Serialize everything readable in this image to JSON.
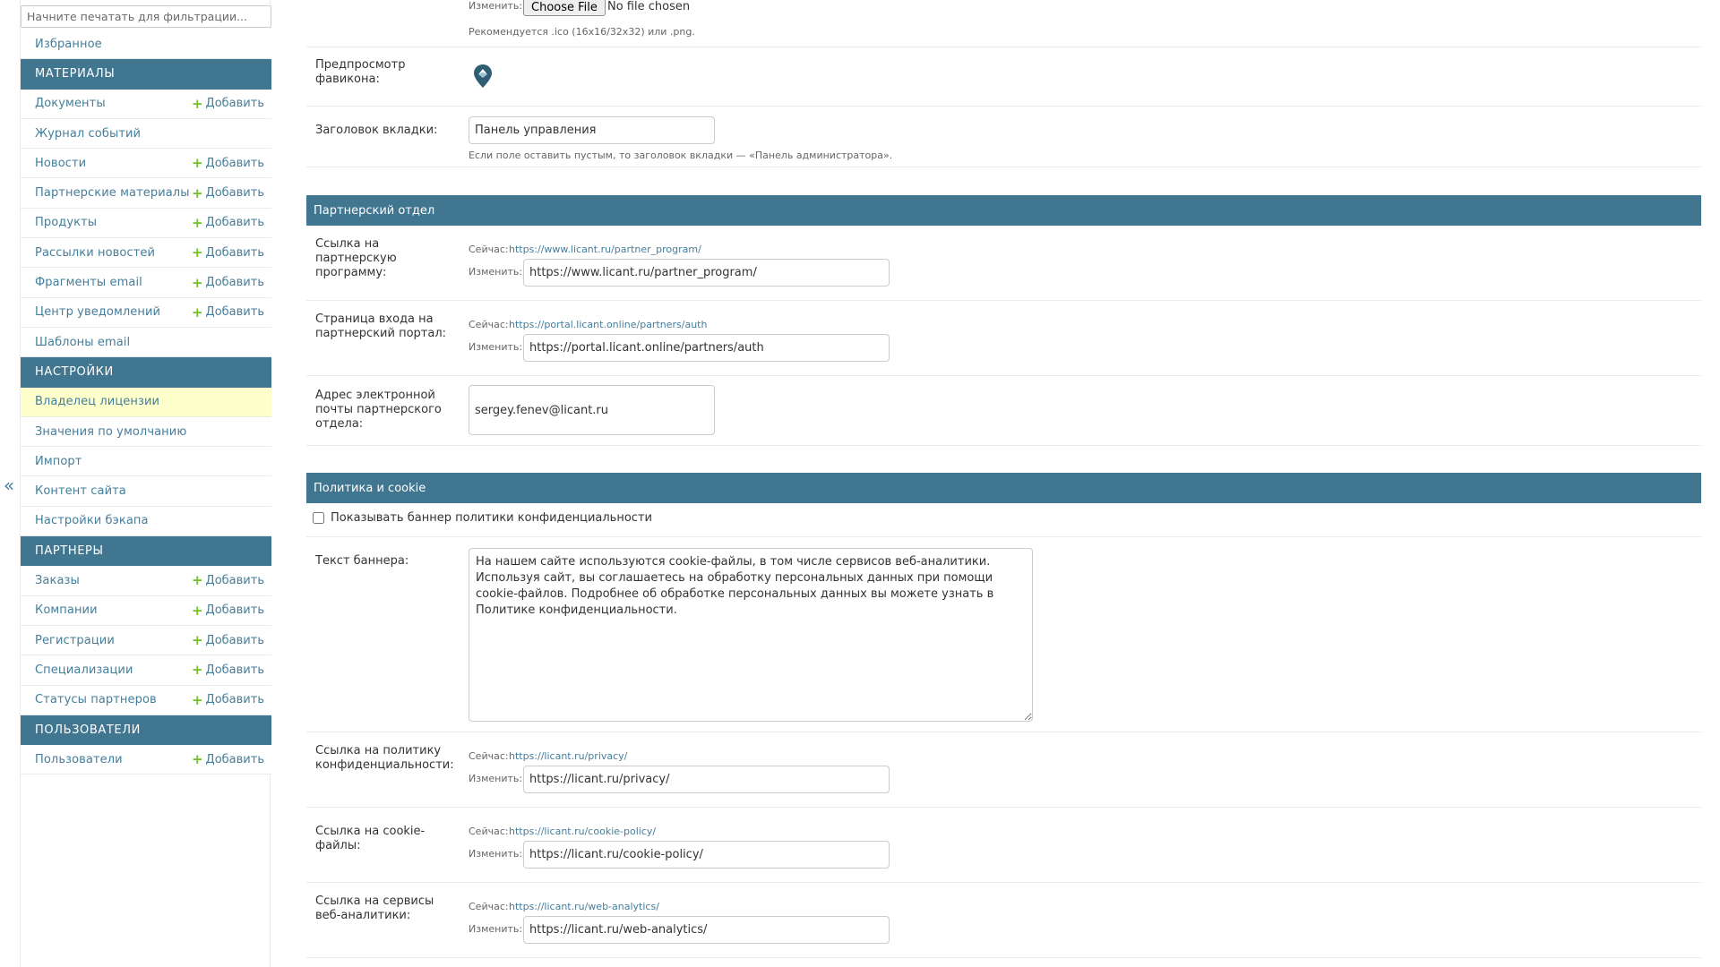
{
  "sidebar": {
    "filter_placeholder": "Начните печатать для фильтрации...",
    "collapse_glyph": "«",
    "add_label": "Добавить",
    "favorites": "Избранное",
    "sections": [
      {
        "title": "МАТЕРИАЛЫ",
        "items": [
          {
            "label": "Документы",
            "add": true
          },
          {
            "label": "Журнал событий",
            "add": false
          },
          {
            "label": "Новости",
            "add": true
          },
          {
            "label": "Партнерские материалы",
            "add": true
          },
          {
            "label": "Продукты",
            "add": true
          },
          {
            "label": "Рассылки новостей",
            "add": true
          },
          {
            "label": "Фрагменты email",
            "add": true
          },
          {
            "label": "Центр уведомлений",
            "add": true
          },
          {
            "label": "Шаблоны email",
            "add": false
          }
        ]
      },
      {
        "title": "НАСТРОЙКИ",
        "items": [
          {
            "label": "Владелец лицензии",
            "add": false,
            "current": true
          },
          {
            "label": "Значения по умолчанию",
            "add": false
          },
          {
            "label": "Импорт",
            "add": false
          },
          {
            "label": "Контент сайта",
            "add": false
          },
          {
            "label": "Настройки бэкапа",
            "add": false
          }
        ]
      },
      {
        "title": "ПАРТНЕРЫ",
        "items": [
          {
            "label": "Заказы",
            "add": true
          },
          {
            "label": "Компании",
            "add": true
          },
          {
            "label": "Регистрации",
            "add": true
          },
          {
            "label": "Специализации",
            "add": true
          },
          {
            "label": "Статусы партнеров",
            "add": true
          }
        ]
      },
      {
        "title": "ПОЛЬЗОВАТЕЛИ",
        "items": [
          {
            "label": "Пользователи",
            "add": true
          }
        ]
      }
    ]
  },
  "main": {
    "favicon": {
      "change_label": "Изменить:",
      "choose_file": "Choose File",
      "no_file": "No file chosen",
      "help": "Рекомендуется .ico (16x16/32x32) или .png.",
      "preview_label": "Предпросмотр фавикона:"
    },
    "tab_title": {
      "label": "Заголовок вкладки:",
      "value": "Панель управления",
      "help": "Если поле оставить пустым, то заголовок вкладки — «Панель администратора»."
    },
    "partner_section": {
      "title": "Партнерский отдел",
      "program": {
        "label": "Ссылка на партнерскую программу:",
        "current_label": "Сейчас:",
        "current": "https://www.licant.ru/partner_program/",
        "change_label": "Изменить:",
        "value": "https://www.licant.ru/partner_program/"
      },
      "portal": {
        "label": "Страница входа на партнерский портал:",
        "current_label": "Сейчас:",
        "current": "https://portal.licant.online/partners/auth",
        "change_label": "Изменить:",
        "value": "https://portal.licant.online/partners/auth"
      },
      "email": {
        "label": "Адрес электронной почты партнерского отдела:",
        "value": "sergey.fenev@licant.ru"
      }
    },
    "policy_section": {
      "title": "Политика и cookie",
      "show_banner_label": "Показывать баннер политики конфиденциальности",
      "banner": {
        "label": "Текст баннера:",
        "value": "На нашем сайте используются cookie-файлы, в том числе сервисов веб-аналитики. Используя сайт, вы соглашаетесь на обработку персональных данных при помощи cookie-файлов. Подробнее об обработке персональных данных вы можете узнать в Политике конфиденциальности."
      },
      "privacy": {
        "label": "Ссылка на политику конфиденциальности:",
        "current_label": "Сейчас:",
        "current": "https://licant.ru/privacy/",
        "change_label": "Изменить:",
        "value": "https://licant.ru/privacy/"
      },
      "cookie": {
        "label": "Ссылка на cookie-файлы:",
        "current_label": "Сейчас:",
        "current": "https://licant.ru/cookie-policy/",
        "change_label": "Изменить:",
        "value": "https://licant.ru/cookie-policy/"
      },
      "analytics": {
        "label": "Ссылка на сервисы веб-аналитики:",
        "current_label": "Сейчас:",
        "current": "https://licant.ru/web-analytics/",
        "change_label": "Изменить:",
        "value": "https://licant.ru/web-analytics/"
      }
    }
  },
  "colors": {
    "accent": "#417690",
    "link": "#447e9b",
    "add_plus": "#70bf2b",
    "current_row": "#ffffcc"
  }
}
